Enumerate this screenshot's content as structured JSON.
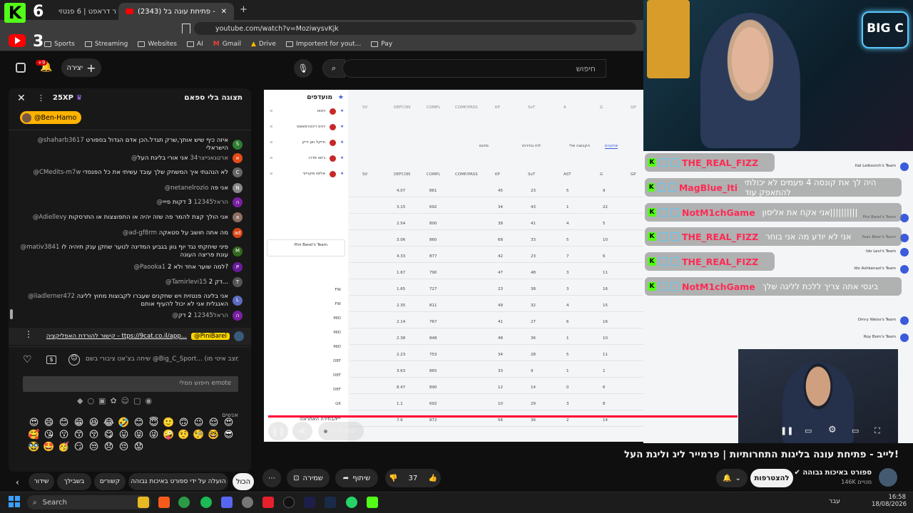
{
  "browser": {
    "tabs": [
      {
        "label": "חדר דראפט | 6 פנטזי"
      },
      {
        "label": "(2343) לייב - פתיחת עונה בל..."
      }
    ],
    "url": "youtube.com/watch?v=MoziwysvKjk",
    "bookmarks": [
      "Sports",
      "Streaming",
      "Websites",
      "AI",
      "Gmail",
      "Drive",
      "Importent for yout...",
      "Pay"
    ]
  },
  "overlay_logo": {
    "big": "K",
    "num1": "6",
    "num2": "3"
  },
  "youtube": {
    "search_placeholder": "חיפוש",
    "create_label": "יצירה",
    "notif_count": "+9"
  },
  "chat": {
    "header_title": "תצוגה בלי ספאם",
    "xp": "25XP",
    "pinned_user": "@Ben-Hamo",
    "messages": [
      {
        "user": "@shaharb3617",
        "text": "איזה כיף שיש אותך,שרק תגדל.הכן אדם הגדול בספורט הישראלי",
        "color": "#2e7d32",
        "initial": "S"
      },
      {
        "user": "@ארטגאנייצר34",
        "text": "אני אורי בליגת העל",
        "color": "#e64a19",
        "initial": "א"
      },
      {
        "user": "@CMedits-m7w",
        "text": "לא הנהגתי איך המשחק שלך עובד עשיתי את כל הפנסדי",
        "color": "#666",
        "initial": "C"
      },
      {
        "user": "@netanelrozio",
        "text": "אני פה",
        "color": "#888",
        "initial": "N"
      },
      {
        "user": "@הראל12345",
        "text": "3 דקות פייי",
        "color": "#7b1fa2",
        "initial": "ה"
      },
      {
        "user": "@Adiellevy",
        "text": "אני הולך קצת להמר פה שזה יהיה או התפוצצות או התרסקות",
        "color": "#8d6e63",
        "initial": "a"
      },
      {
        "user": "@ad-gf8rm",
        "text": "מה אתה חושב על סטאקה",
        "color": "#d84315",
        "initial": "ad"
      },
      {
        "user": "@mativ3841",
        "text": "פיני שיחקתי נגד יוף גוון בגביע המדינה לנוער שחקן ענק תיהיה לו עונת פריצה העונה",
        "color": "#33691e",
        "initial": "M"
      },
      {
        "user": "@Paooka1",
        "text": "למה שוער אחד ולא 2?",
        "color": "#6a1b9a",
        "initial": "P"
      },
      {
        "user": "@Tamirlevi15",
        "text": "2 דק...",
        "color": "#555",
        "initial": "T"
      },
      {
        "user": "@liadlerner472",
        "text": "אני בליגה פנטזית ויש שחקנים שעברו לקבוצות מחוץ לליגה האנגלית אני לא יכול להעיף אותם",
        "color": "#5c6bc0",
        "initial": "L"
      },
      {
        "user": "@הראל12345",
        "text": "2 דק",
        "color": "#7b1fa2",
        "initial": "ה"
      }
    ],
    "pinned_msg_user": "@PiniBarel",
    "pinned_msg_text": "קישור להורדת האפליקציה - ttps://9cat.co.il/app...",
    "input_placeholder": "שיחה בצ'אט ציבורי בשם @Big_C_Sport... (מצב איטי מו...",
    "emote_search": "חיפוש סמלי emote",
    "emoji_label": "אנשים",
    "emoji": [
      "😍",
      "😄",
      "😊",
      "😁",
      "😆",
      "😂",
      "🤣",
      "😊",
      "😇",
      "🙂",
      "🙃",
      "😉",
      "😌",
      "😍",
      "🥰",
      "😘",
      "😗",
      "😙",
      "😚",
      "😋",
      "😛",
      "😝",
      "😜",
      "🤪",
      "🤨",
      "🧐",
      "🤓",
      "😎",
      "🥸",
      "🤩",
      "🥳",
      "😏",
      "😒",
      "😞",
      "😔",
      "😟",
      "😕",
      "🙁"
    ]
  },
  "sheet": {
    "tabs": [
      "שחקנים",
      "הקבוצה שלי",
      "לוח בחירות",
      "סיכום"
    ],
    "favorites_title": "מועדפים",
    "favorites": [
      "ויטאו",
      "דניס ריכטרסאסט",
      "חייקל ואן דייק",
      "ג'ואו פדרו",
      "אליסו מקנייזר"
    ],
    "top_headers": [
      "GP",
      "G",
      "A",
      "SoT",
      "KP",
      "COMP/PASS",
      "COMPL",
      "DEFCON",
      "SV"
    ],
    "headers": [
      "GP",
      "G",
      "AST",
      "SoT",
      "KP",
      "COMP/PASS",
      "COMPL",
      "DEFCON",
      "SV"
    ],
    "rows": [
      [
        "9",
        "5",
        "23",
        "45",
        "861",
        "4.07"
      ],
      [
        "22",
        "1",
        "43",
        "34",
        "692",
        "3.15"
      ],
      [
        "5",
        "4",
        "41",
        "38",
        "800",
        "2.54"
      ],
      [
        "10",
        "5",
        "33",
        "68",
        "860",
        "3.06"
      ],
      [
        "6",
        "7",
        "23",
        "42",
        "877",
        "4.33"
      ],
      [
        "11",
        "3",
        "48",
        "47",
        "790",
        "1.67"
      ],
      [
        "16",
        "3",
        "38",
        "23",
        "727",
        "1.65"
      ],
      [
        "15",
        "4",
        "32",
        "49",
        "811",
        "2.35"
      ],
      [
        "16",
        "6",
        "27",
        "41",
        "767",
        "2.14"
      ],
      [
        "10",
        "1",
        "36",
        "48",
        "848",
        "2.38"
      ],
      [
        "11",
        "5",
        "28",
        "34",
        "753",
        "2.23"
      ],
      [
        "1",
        "1",
        "9",
        "33",
        "865",
        "3.63"
      ],
      [
        "6",
        "0",
        "14",
        "12",
        "890",
        "8.47"
      ],
      [
        "8",
        "3",
        "29",
        "10",
        "692",
        "1.1"
      ],
      [
        "14",
        "2",
        "36",
        "56",
        "872",
        "7.6"
      ]
    ],
    "team_label": "Pini Barel's Team",
    "positions": [
      "FW",
      "FW",
      "MID",
      "MID",
      "MID",
      "DEF",
      "DEF",
      "DEF",
      "GK",
      "GK"
    ],
    "right_teams": [
      "Ital Leibovich's Team",
      "Pini Barel's Team",
      "Yoav Beer's Team",
      "Ido Levi's Team",
      "Ido Ashkenazi's Team",
      "Omry Weiss's Team",
      "Roy Bom's Team"
    ],
    "bottom_text": "הבחירה האחרונה"
  },
  "overlay_chat": [
    {
      "user": "THE_REAL_FIZZ",
      "msg": ""
    },
    {
      "user": "MagBlue_Iti",
      "msg": "היה לך את קונסה 4 פעמים לא יכולתי להתאפק עוד"
    },
    {
      "user": "NotM1chGame",
      "msg": "אני אקח את אליסון||||||||||"
    },
    {
      "user": "THE_REAL_FIZZ",
      "msg": "אני לא יודע מה אני בוחר"
    },
    {
      "user": "THE_REAL_FIZZ",
      "msg": ""
    },
    {
      "user": "NotM1chGame",
      "msg": "ביגסי אתה צריך ללכת לליגה שלך"
    }
  ],
  "stream_logo": "BIG C",
  "player": {
    "live_label": "בשידור חי"
  },
  "video": {
    "title": "לייב - פתיחת עונה בליגות התחרותיות | פרמייר ליג וליגת העל!",
    "channel": "ספורט באיכות גבוהה",
    "subs": "146K מנויים",
    "join": "להצטרפות",
    "likes": "37",
    "share": "שיתוף",
    "save": "שמירה"
  },
  "chips": [
    "הכול",
    "הועלה על ידי ספורט באיכות גבוהה",
    "קשורים",
    "בשבילך",
    "שידור"
  ],
  "taskbar": {
    "search": "Search",
    "lang": "עבר",
    "time": "16:58",
    "date": "18/08/2026"
  }
}
